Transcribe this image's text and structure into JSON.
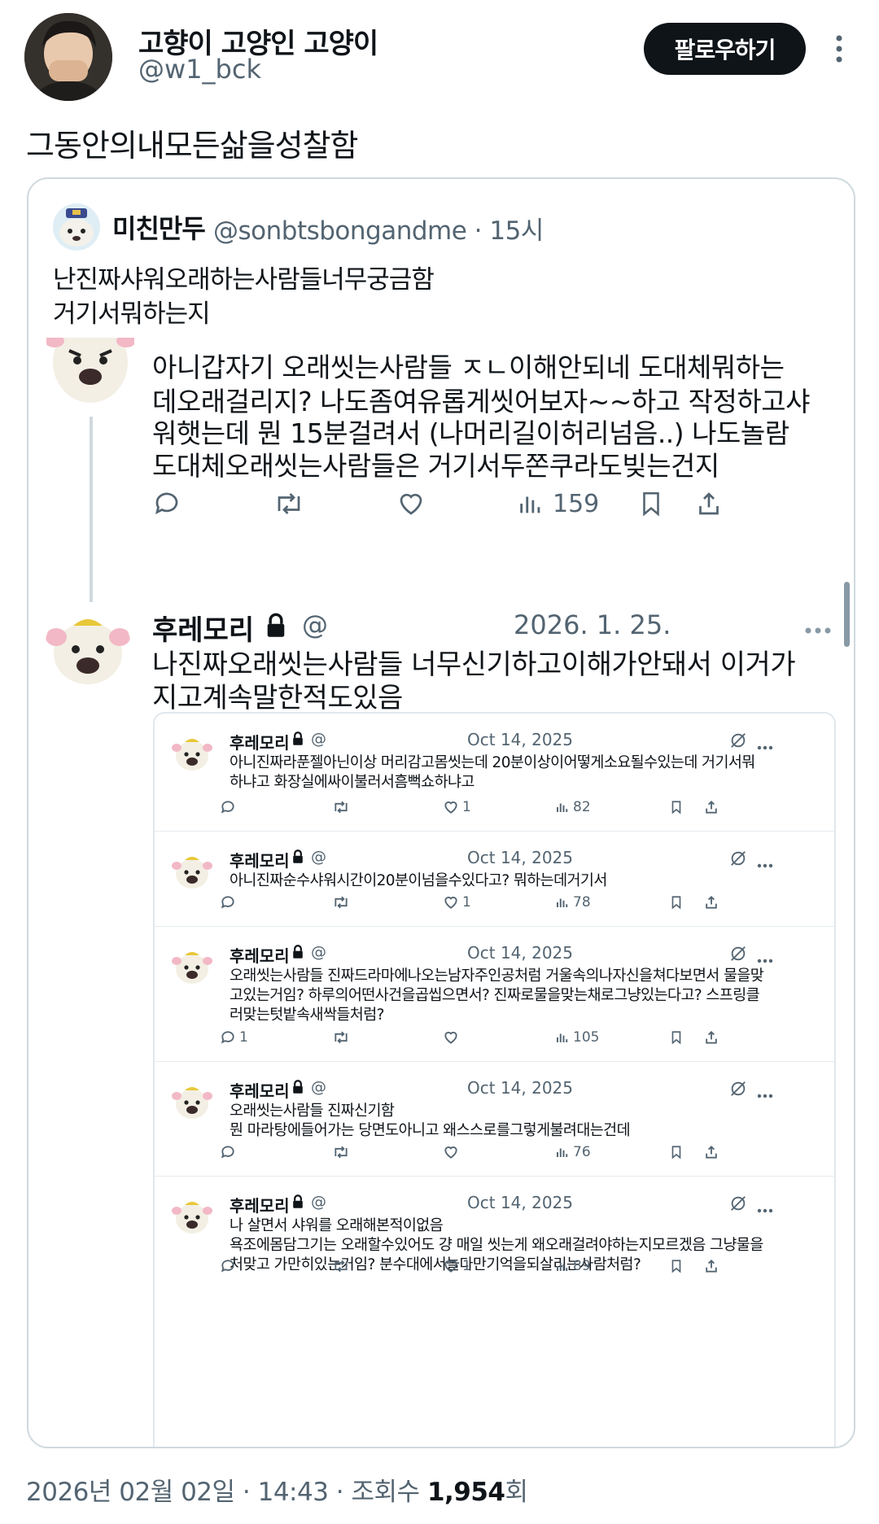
{
  "author": {
    "name": "고향이 고양인 고양이",
    "handle": "@w1_bck",
    "follow_label": "팔로우하기"
  },
  "post_text": "그동안의내모든삶을성찰함",
  "quote": {
    "name": "미친만두",
    "handle_time": "@sonbtsbongandme · 15시",
    "text_lines": [
      "난진짜샤워오래하는사람들너무궁금함",
      "거기서뭐하는지"
    ]
  },
  "reply1": {
    "lines": [
      "아니갑자기 오래씻는사람들 ㅈㄴ이해안되네 도대체뭐하는",
      "데오래걸리지? 나도좀여유롭게씻어보자~~하고 작정하고샤",
      "워햇는데 뭔 15분걸려서 (나머리길이허리넘음..) 나도놀람",
      "도대체오래씻는사람들은 거기서두쫀쿠라도빚는건지"
    ],
    "views": "159"
  },
  "reply2": {
    "name": "후레모리",
    "at": "@",
    "date": "2026. 1. 25.",
    "lines": [
      "나진짜오래씻는사람들 너무신기하고이해가안돼서 이거가",
      "지고계속말한적도있음"
    ]
  },
  "inner_posts": [
    {
      "name": "후레모리",
      "at": "@",
      "date": "Oct 14, 2025",
      "lines": [
        "아니진짜라푼젤아닌이상 머리감고몸씻는데 20분이상이어떻게소요될수있는데 거기서뭐",
        "하냐고 화장실에싸이불러서흠뻑쇼하냐고"
      ],
      "replies": "",
      "likes": "1",
      "views": "82"
    },
    {
      "name": "후레모리",
      "at": "@",
      "date": "Oct 14, 2025",
      "lines": [
        "아니진짜순수샤워시간이20분이넘을수있다고? 뭐하는데거기서"
      ],
      "replies": "",
      "likes": "1",
      "views": "78"
    },
    {
      "name": "후레모리",
      "at": "@",
      "date": "Oct 14, 2025",
      "lines": [
        "오래씻는사람들 진짜드라마에나오는남자주인공처럼 거울속의나자신을쳐다보면서 물을맞",
        "고있는거임? 하루의어떤사건을곱씹으면서? 진짜로물을맞는채로그냥있는다고? 스프링클",
        "러맞는텃밭속새싹들처럼?"
      ],
      "replies": "1",
      "likes": "",
      "views": "105"
    },
    {
      "name": "후레모리",
      "at": "@",
      "date": "Oct 14, 2025",
      "lines": [
        "오래씻는사람들 진짜신기함",
        "뭔 마라탕에들어가는 당면도아니고 왜스스로를그렇게불려대는건데"
      ],
      "replies": "",
      "likes": "",
      "views": "76"
    },
    {
      "name": "후레모리",
      "at": "@",
      "date": "Oct 14, 2025",
      "lines": [
        "나 살면서 샤워를 오래해본적이없음",
        "욕조에몸담그기는 오래할수있어도 걍 매일 씻는게 왜오래걸려야하는지모르겠음 그냥물을",
        "처맞고 가만히있는거임? 분수대에서놀다만기억을되살리는사람처럼?"
      ],
      "replies": "",
      "likes": "1",
      "views": "89"
    }
  ],
  "footer": {
    "datetime": "2026년 02월 02일 · 14:43 · 조회수 ",
    "views": "1,954",
    "suffix": "회"
  },
  "colors": {
    "text": "#0f1419",
    "secondary": "#536471",
    "border": "#cfd9de",
    "button": "#0f1419"
  },
  "icons": [
    "more-vertical-icon",
    "reply-icon",
    "retweet-icon",
    "like-icon",
    "views-icon",
    "bookmark-icon",
    "share-icon",
    "lock-icon",
    "grok-icon",
    "more-horizontal-icon"
  ]
}
